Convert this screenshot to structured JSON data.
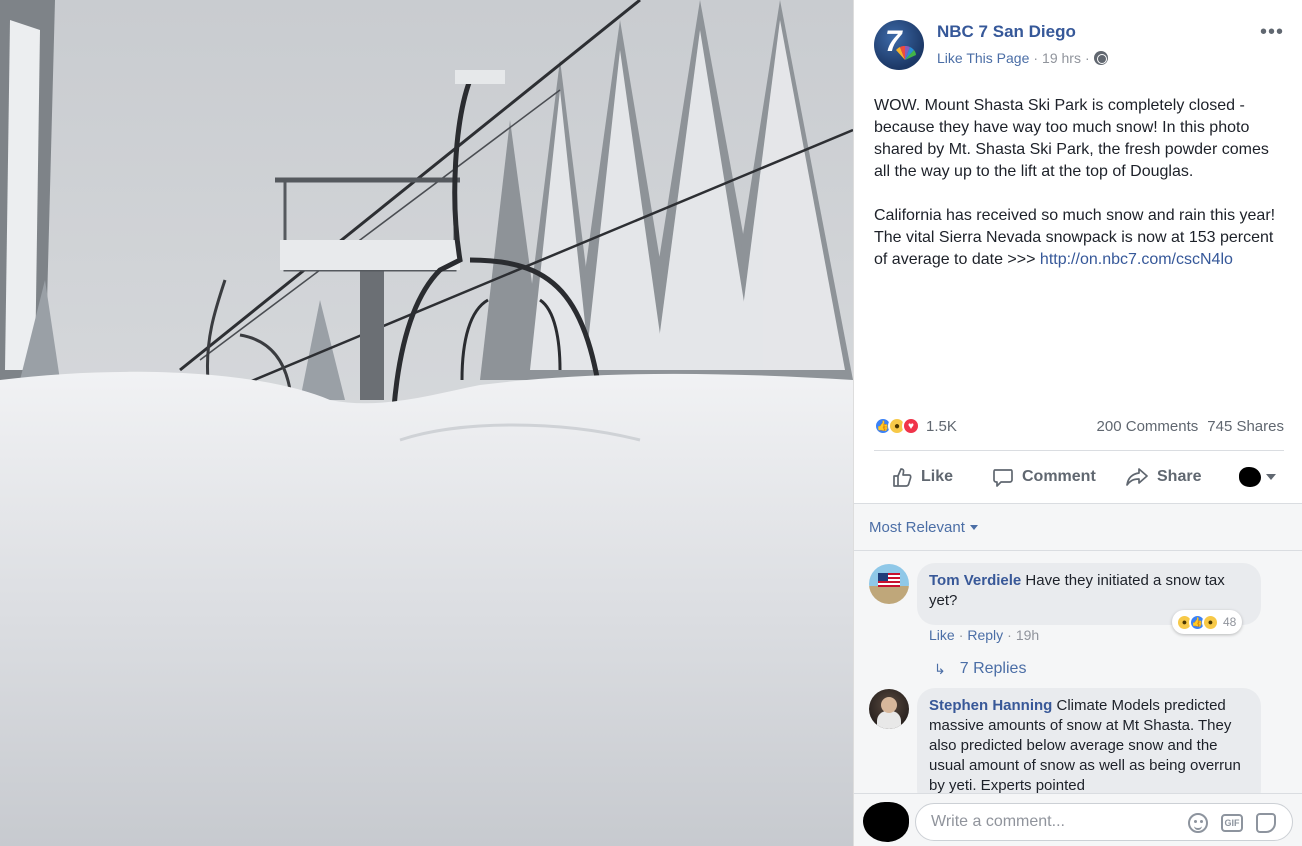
{
  "post": {
    "page_name": "NBC 7 San Diego",
    "avatar_text": "7",
    "like_page": "Like This Page",
    "time": "19 hrs",
    "paragraph1": "WOW. Mount Shasta Ski Park is completely closed - because they have way too much snow! In this photo shared by Mt. Shasta Ski Park, the fresh powder comes all the way up to the lift at the top of Douglas.",
    "paragraph2": "California has received so much snow and rain this year! The vital Sierra Nevada snowpack is now at 153 percent of average to date >>>",
    "link": "http://on.nbc7.com/cscN4lo",
    "more_icon": "ellipsis-icon",
    "more_glyph": "•••"
  },
  "reactions": {
    "count": "1.5K",
    "comments": "200 Comments",
    "shares": "745 Shares"
  },
  "actions": {
    "like": "Like",
    "comment": "Comment",
    "share": "Share"
  },
  "comments": {
    "sort_label": "Most Relevant",
    "items": [
      {
        "author": "Tom Verdiele",
        "text": " Have they initiated a snow tax yet?",
        "like": "Like",
        "reply": "Reply",
        "time": "19h",
        "reaction_count": "48",
        "replies": "7 Replies"
      },
      {
        "author": "Stephen Hanning",
        "text": " Climate Models predicted massive amounts of snow at Mt Shasta. They also predicted below average snow and the usual amount of snow as well as being overrun by yeti. Experts pointed"
      }
    ]
  },
  "composer": {
    "placeholder": "Write a comment...",
    "gif_label": "GIF"
  },
  "colors": {
    "link": "#365899",
    "text": "#1d2129",
    "muted": "#90949c"
  }
}
